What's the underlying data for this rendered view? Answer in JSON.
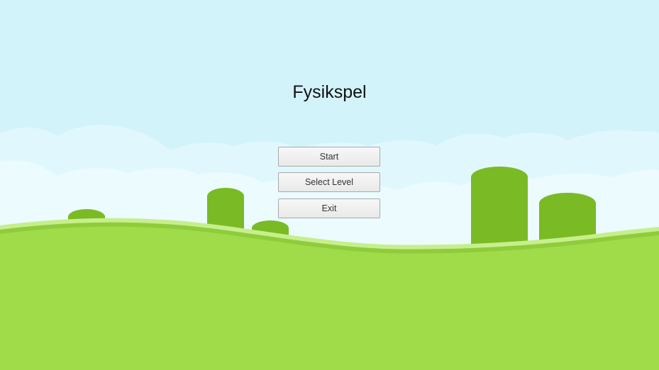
{
  "game": {
    "title": "Fysikspel"
  },
  "menu": {
    "start_label": "Start",
    "select_level_label": "Select Level",
    "exit_label": "Exit"
  },
  "colors": {
    "sky": "#d3f3fb",
    "cloud_far": "#e4f9fd",
    "cloud_near": "#eefcfe",
    "hill_light": "#c6ef8c",
    "hill_mid": "#8fcc3c",
    "ground": "#a0dc4a",
    "bush": "#7aba25"
  }
}
